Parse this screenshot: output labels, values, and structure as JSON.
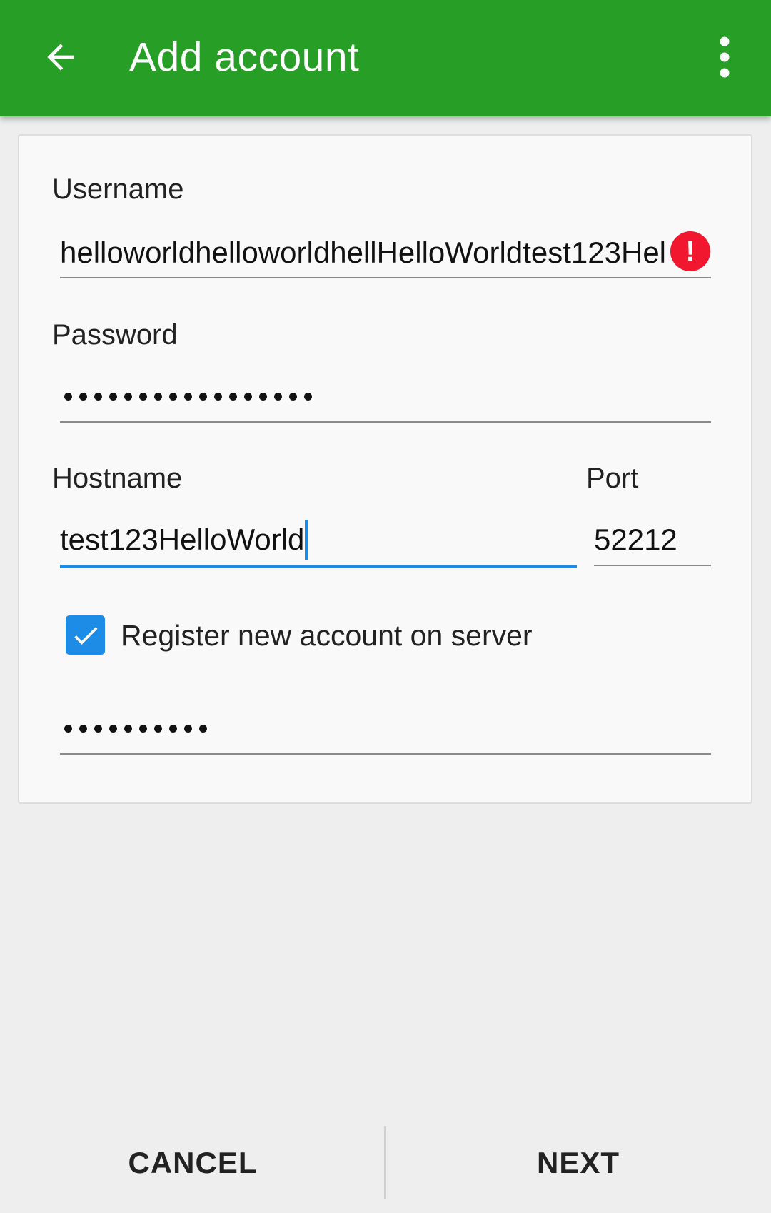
{
  "appbar": {
    "title": "Add account",
    "back_icon": "arrow-back-icon",
    "overflow_icon": "more-vert-icon",
    "color": "#279e26"
  },
  "form": {
    "username": {
      "label": "Username",
      "value": "helloworldhelloworldhellHelloWorldtest123Hel",
      "error_icon": "error-icon",
      "error_color": "#f0172f"
    },
    "password": {
      "label": "Password",
      "masked_length": 17
    },
    "hostname": {
      "label": "Hostname",
      "value": "test123HelloWorld"
    },
    "port": {
      "label": "Port",
      "value": "52212"
    },
    "register": {
      "label": "Register new account on server",
      "checked": true
    },
    "confirm_password": {
      "masked_length": 10
    }
  },
  "buttons": {
    "cancel": "CANCEL",
    "next": "NEXT"
  },
  "accent_color": "#1c8ce6"
}
